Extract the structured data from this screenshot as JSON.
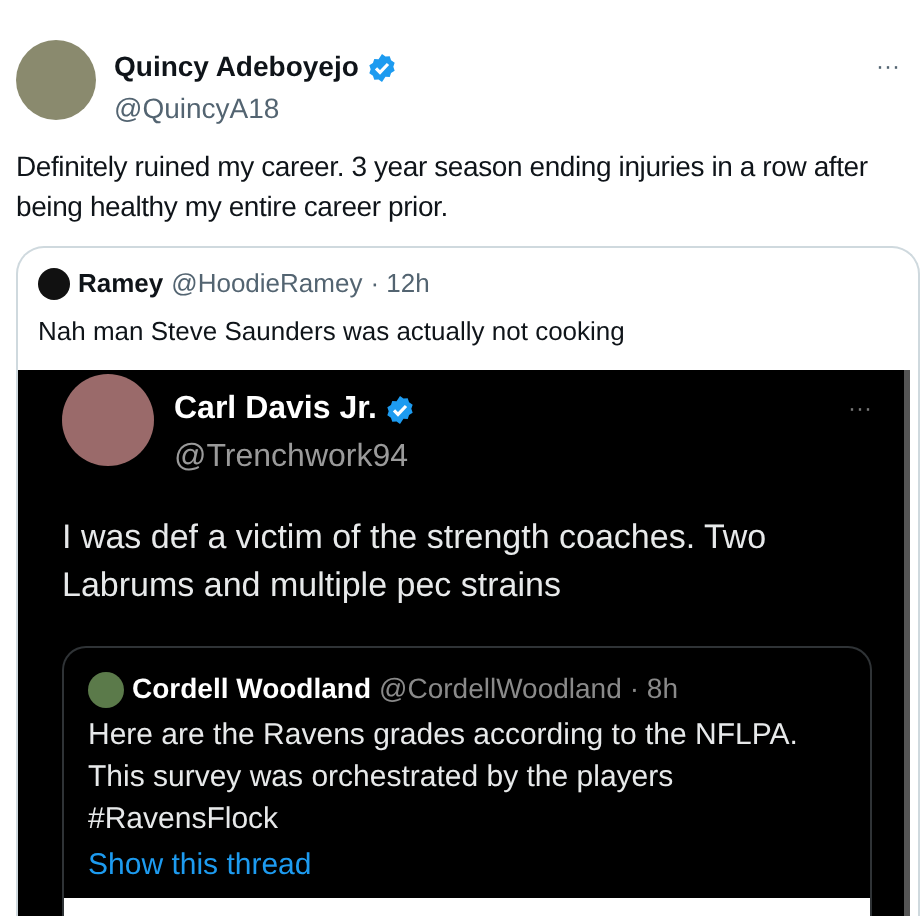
{
  "tweet": {
    "name": "Quincy Adeboyejo",
    "verified": true,
    "handle": "@QuincyA18",
    "more": "···",
    "text": "Definitely ruined my career. 3 year season ending injuries in a row after being healthy my entire career prior.",
    "quote": {
      "name": "Ramey",
      "handle": "@HoodieRamey",
      "time": "· 12h",
      "text": "Nah man Steve Saunders was actually not cooking",
      "screenshot": {
        "name": "Carl Davis Jr.",
        "verified": true,
        "handle": "@Trenchwork94",
        "more": "···",
        "text": "I was def a victim of the strength coaches. Two Labrums and multiple pec strains",
        "quote": {
          "name": "Cordell Woodland",
          "handle": "@CordellWoodland",
          "time": "· 8h",
          "text": "Here are the Ravens grades according to the NFLPA. This survey was orchestrated by the players #RavensFlock",
          "link": "Show this thread"
        }
      }
    }
  }
}
